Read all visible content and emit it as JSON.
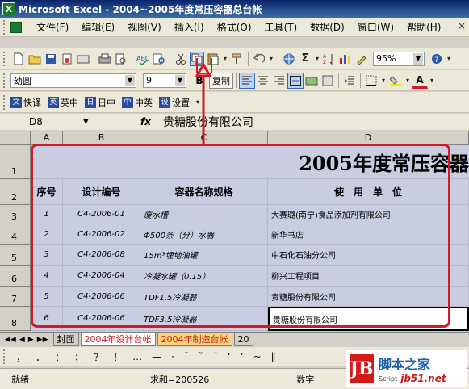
{
  "titlebar": {
    "app_icon": "X",
    "title": "Microsoft Excel - 2004~2005年度常压容器总台帐"
  },
  "menubar": {
    "items": [
      "文件(F)",
      "编辑(E)",
      "视图(V)",
      "插入(I)",
      "格式(O)",
      "工具(T)",
      "数据(D)",
      "窗口(W)",
      "帮助(H)"
    ],
    "controls": [
      "_",
      "×"
    ]
  },
  "toolbar": {
    "sigma": "Σ",
    "zoom": "95%"
  },
  "format_toolbar": {
    "font": "幼圆",
    "size": "9",
    "bold": "B",
    "copy_label": "复制",
    "color_a": "A"
  },
  "translate_toolbar": {
    "buttons": [
      {
        "icon": "文",
        "label": "快译"
      },
      {
        "icon": "英",
        "label": "英中"
      },
      {
        "icon": "日",
        "label": "日中"
      },
      {
        "icon": "中",
        "label": "中英"
      },
      {
        "icon": "设",
        "label": "设置"
      }
    ]
  },
  "formula_bar": {
    "name_box": "D8",
    "fx": "fx",
    "content": "贵糖股份有限公司"
  },
  "columns": [
    "A",
    "B",
    "C",
    "D"
  ],
  "rows": [
    "1",
    "2",
    "3",
    "4",
    "5",
    "6",
    "7",
    "8"
  ],
  "sheet": {
    "title": "2005年度常压容器",
    "headers": [
      "序号",
      "设计编号",
      "容器名称规格",
      "使　用　单　位"
    ],
    "data": [
      [
        "1",
        "C4-2006-01",
        "废水槽",
        "大赛璐(南宁)食品添加剂有限公司"
      ],
      [
        "2",
        "C4-2006-02",
        "Φ500条（分）水器",
        "新华书店"
      ],
      [
        "3",
        "C4-2006-08",
        "15m³埋地油罐",
        "中石化石油分公司"
      ],
      [
        "4",
        "C4-2006-04",
        "冷凝水罐（0.15）",
        "柳兴工程项目"
      ],
      [
        "5",
        "C4-2006-06",
        "TDF1.5冷凝器",
        "贵糖股份有限公司"
      ],
      [
        "6",
        "C4-2006-06",
        "TDF3.5冷凝器",
        "贵糖股份有限公司"
      ]
    ]
  },
  "sheet_tabs": [
    "封面",
    "2004年设计台帐",
    "2004年制造台帐",
    "20"
  ],
  "symbol_bar": [
    "，",
    "．",
    "：",
    "；",
    "？",
    "！",
    "…",
    "—",
    "·",
    "ˉ",
    "ˇ",
    "¨",
    "‘",
    "’",
    "~",
    "‖"
  ],
  "statusbar": {
    "ready": "就绪",
    "sum": "求和=200526",
    "mode": "数字"
  },
  "watermark": {
    "logo": "JB",
    "cn": "脚本之家",
    "script": "Script",
    "url": "jb51.net"
  }
}
